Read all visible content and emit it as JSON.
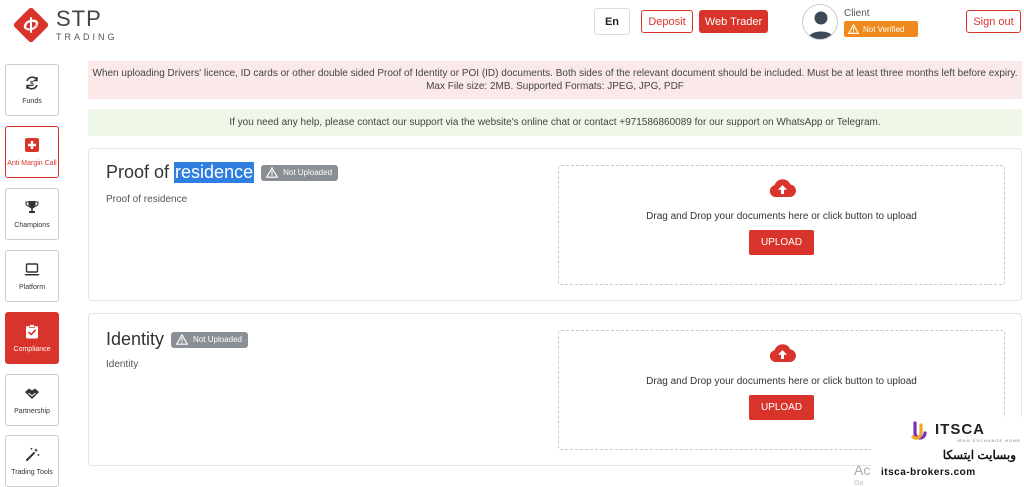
{
  "header": {
    "logo_name": "STP",
    "logo_sub": "TRADING",
    "lang": "En",
    "deposit": "Deposit",
    "web_trader": "Web Trader",
    "client_label": "Client",
    "verify_status": "Not Verified",
    "sign_out": "Sign out"
  },
  "sidebar": {
    "items": [
      {
        "label": "Funds",
        "icon": "funds-icon"
      },
      {
        "label": "Anti Margin Call",
        "icon": "medical-cross-icon"
      },
      {
        "label": "Champions",
        "icon": "trophy-icon"
      },
      {
        "label": "Platform",
        "icon": "laptop-icon"
      },
      {
        "label": "Compliance",
        "icon": "clipboard-check-icon"
      },
      {
        "label": "Partnership",
        "icon": "handshake-icon"
      },
      {
        "label": "Trading Tools",
        "icon": "magic-wand-icon"
      }
    ],
    "active": "Compliance"
  },
  "notices": {
    "upload_rules": "When uploading Drivers' licence, ID cards or other double sided Proof of Identity or POI (ID) documents. Both sides of the relevant document should be included. Must be at least three months left before expiry. Max File size: 2MB. Supported Formats: JPEG, JPG, PDF",
    "help": "If you need any help, please contact our support via the website's online chat or contact +971586860089 for our support on WhatsApp or Telegram."
  },
  "cards": [
    {
      "title_prefix": "Proof of ",
      "title_highlight": "residence",
      "status": "Not Uploaded",
      "subtitle": "Proof of residence",
      "drop_text": "Drag and Drop your documents here or click button to upload",
      "upload": "UPLOAD"
    },
    {
      "title": "Identity",
      "status": "Not Uploaded",
      "subtitle": "Identity",
      "drop_text": "Drag and Drop your documents here or click button to upload",
      "upload": "UPLOAD"
    }
  ],
  "watermark": {
    "brand": "ITSCA",
    "sub": "IRAN EXCHANGE HOME",
    "fa_text": "وبسایت ایتسکا",
    "url": "itsca-brokers.com"
  },
  "activate_hint": "Ac",
  "activate_hint2": "Go",
  "colors": {
    "brand_red": "#d9342b",
    "badge_grey": "#8a8f96",
    "warning_orange": "#f08a1c"
  }
}
